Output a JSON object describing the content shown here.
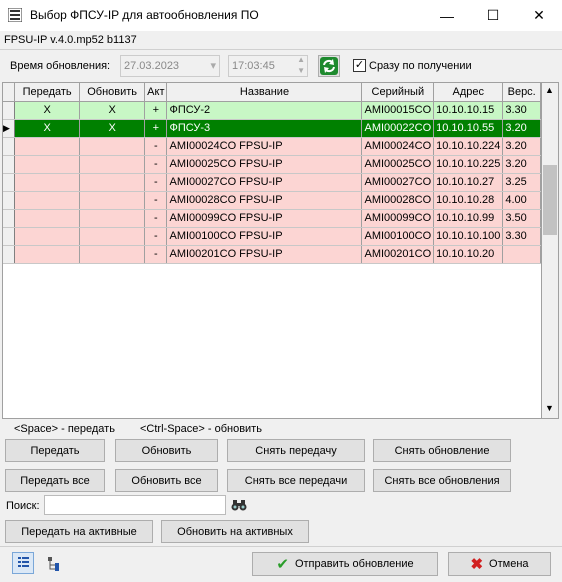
{
  "window": {
    "title": "Выбор ФПСУ-IP для автообновления ПО",
    "minimize": "—",
    "maximize": "☐",
    "close": "✕"
  },
  "version": "FPSU-IP v.4.0.mp52 b1137",
  "update_time": {
    "label": "Время обновления:",
    "date": "27.03.2023",
    "time": "17:03:45",
    "instant_label": "Сразу по получении",
    "instant_checked": true
  },
  "grid": {
    "headers": [
      "Передать",
      "Обновить",
      "Акт",
      "Название",
      "Серийный",
      "Адрес",
      "Верс."
    ],
    "rows": [
      {
        "style": "green",
        "send": "X",
        "update": "X",
        "act": "+",
        "name": "ФПСУ-2",
        "serial": "AMI00015CO",
        "address": "10.10.10.15",
        "version": "3.30",
        "current": false
      },
      {
        "style": "sel",
        "send": "X",
        "update": "X",
        "act": "+",
        "name": "ФПСУ-3",
        "serial": "AMI00022CO",
        "address": "10.10.10.55",
        "version": "3.20",
        "current": true
      },
      {
        "style": "pink",
        "send": "",
        "update": "",
        "act": "-",
        "name": "AMI00024CO FPSU-IP",
        "serial": "AMI00024CO",
        "address": "10.10.10.224",
        "version": "3.20",
        "current": false
      },
      {
        "style": "pink",
        "send": "",
        "update": "",
        "act": "-",
        "name": "AMI00025CO FPSU-IP",
        "serial": "AMI00025CO",
        "address": "10.10.10.225",
        "version": "3.20",
        "current": false
      },
      {
        "style": "pink",
        "send": "",
        "update": "",
        "act": "-",
        "name": "AMI00027CO FPSU-IP",
        "serial": "AMI00027CO",
        "address": "10.10.10.27",
        "version": "3.25",
        "current": false
      },
      {
        "style": "pink",
        "send": "",
        "update": "",
        "act": "-",
        "name": "AMI00028CO FPSU-IP",
        "serial": "AMI00028CO",
        "address": "10.10.10.28",
        "version": "4.00",
        "current": false
      },
      {
        "style": "pink",
        "send": "",
        "update": "",
        "act": "-",
        "name": "AMI00099CO FPSU-IP",
        "serial": "AMI00099CO",
        "address": "10.10.10.99",
        "version": "3.50",
        "current": false
      },
      {
        "style": "pink",
        "send": "",
        "update": "",
        "act": "-",
        "name": "AMI00100CO FPSU-IP",
        "serial": "AMI00100CO",
        "address": "10.10.10.100",
        "version": "3.30",
        "current": false
      },
      {
        "style": "pink",
        "send": "",
        "update": "",
        "act": "-",
        "name": "AMI00201CO FPSU-IP",
        "serial": "AMI00201CO",
        "address": "10.10.10.20",
        "version": "",
        "current": false
      }
    ]
  },
  "hints": {
    "space": "<Space> - передать",
    "ctrl_space": "<Ctrl-Space> - обновить"
  },
  "buttons": {
    "send": "Передать",
    "update": "Обновить",
    "unset_send": "Снять передачу",
    "unset_update": "Снять обновление",
    "send_all": "Передать все",
    "update_all": "Обновить все",
    "unset_all_send": "Снять все передачи",
    "unset_all_update": "Снять все обновления",
    "send_active": "Передать на активные",
    "update_active": "Обновить на активных",
    "submit": "Отправить обновление",
    "cancel": "Отмена"
  },
  "search": {
    "label": "Поиск:",
    "value": ""
  }
}
